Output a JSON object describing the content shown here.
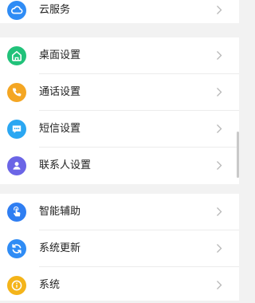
{
  "groups": [
    {
      "items": [
        {
          "label": "云服务",
          "icon": "cloud-icon",
          "color": "#2f8cf5"
        }
      ]
    },
    {
      "items": [
        {
          "label": "桌面设置",
          "icon": "home-icon",
          "color": "#21c27a"
        },
        {
          "label": "通话设置",
          "icon": "phone-icon",
          "color": "#f4a623"
        },
        {
          "label": "短信设置",
          "icon": "message-icon",
          "color": "#2ba7f2"
        },
        {
          "label": "联系人设置",
          "icon": "contact-icon",
          "color": "#6b65e6"
        }
      ]
    },
    {
      "items": [
        {
          "label": "智能辅助",
          "icon": "touch-icon",
          "color": "#2f7ef2"
        },
        {
          "label": "系统更新",
          "icon": "refresh-icon",
          "color": "#2f8cf5"
        },
        {
          "label": "系统",
          "icon": "info-icon",
          "color": "#f4b41a"
        }
      ]
    }
  ],
  "chevron_icon": "chevron-right-icon"
}
